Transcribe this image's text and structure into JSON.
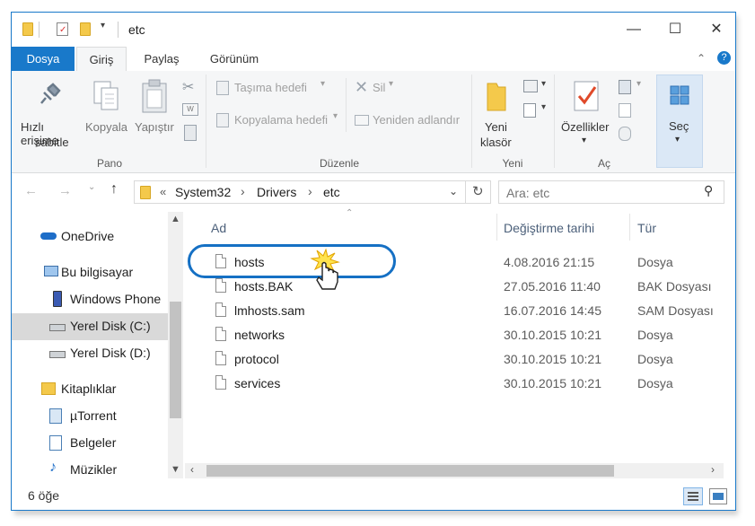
{
  "title_bar": {
    "title": "etc"
  },
  "ribbon_tabs": [
    "Dosya",
    "Giriş",
    "Paylaş",
    "Görünüm"
  ],
  "ribbon": {
    "pin_label_1": "Hızlı erişime",
    "pin_label_2": "sabitle",
    "copy_label": "Kopyala",
    "paste_label": "Yapıştır",
    "move_to_label": "Taşıma hedefi",
    "copy_to_label": "Kopyalama hedefi",
    "delete_label": "Sil",
    "rename_label": "Yeniden adlandır",
    "new_folder_label_1": "Yeni",
    "new_folder_label_2": "klasör",
    "properties_label": "Özellikler",
    "select_label": "Seç",
    "group_pano": "Pano",
    "group_duzenle": "Düzenle",
    "group_yeni": "Yeni",
    "group_ac": "Aç"
  },
  "address": {
    "overflow": "«",
    "crumbs": [
      "System32",
      "Drivers",
      "etc"
    ],
    "separator": "›"
  },
  "search": {
    "placeholder": "Ara: etc"
  },
  "nav": [
    {
      "label": "OneDrive",
      "icon": "cloud-icon"
    },
    {
      "label": "Bu bilgisayar",
      "icon": "computer-icon"
    },
    {
      "label": "Windows Phone",
      "icon": "phone-icon"
    },
    {
      "label": "Yerel Disk (C:)",
      "icon": "drive-icon",
      "selected": true
    },
    {
      "label": "Yerel Disk (D:)",
      "icon": "drive-icon"
    },
    {
      "label": "Kitaplıklar",
      "icon": "library-icon"
    },
    {
      "label": "µTorrent",
      "icon": "library-item-icon"
    },
    {
      "label": "Belgeler",
      "icon": "documents-icon"
    },
    {
      "label": "Müzikler",
      "icon": "music-icon"
    }
  ],
  "columns": {
    "name": "Ad",
    "date": "Değiştirme tarihi",
    "type": "Tür"
  },
  "files": [
    {
      "name": "hosts",
      "date": "4.08.2016 21:15",
      "type": "Dosya",
      "highlighted": true
    },
    {
      "name": "hosts.BAK",
      "date": "27.05.2016 11:40",
      "type": "BAK Dosyası"
    },
    {
      "name": "lmhosts.sam",
      "date": "16.07.2016 14:45",
      "type": "SAM Dosyası"
    },
    {
      "name": "networks",
      "date": "30.10.2015 10:21",
      "type": "Dosya"
    },
    {
      "name": "protocol",
      "date": "30.10.2015 10:21",
      "type": "Dosya"
    },
    {
      "name": "services",
      "date": "30.10.2015 10:21",
      "type": "Dosya"
    }
  ],
  "status": {
    "item_count": "6 öğe"
  },
  "colors": {
    "accent": "#1979ca",
    "highlight_ring": "#1570c4",
    "selected_nav": "#d9d9d9"
  }
}
